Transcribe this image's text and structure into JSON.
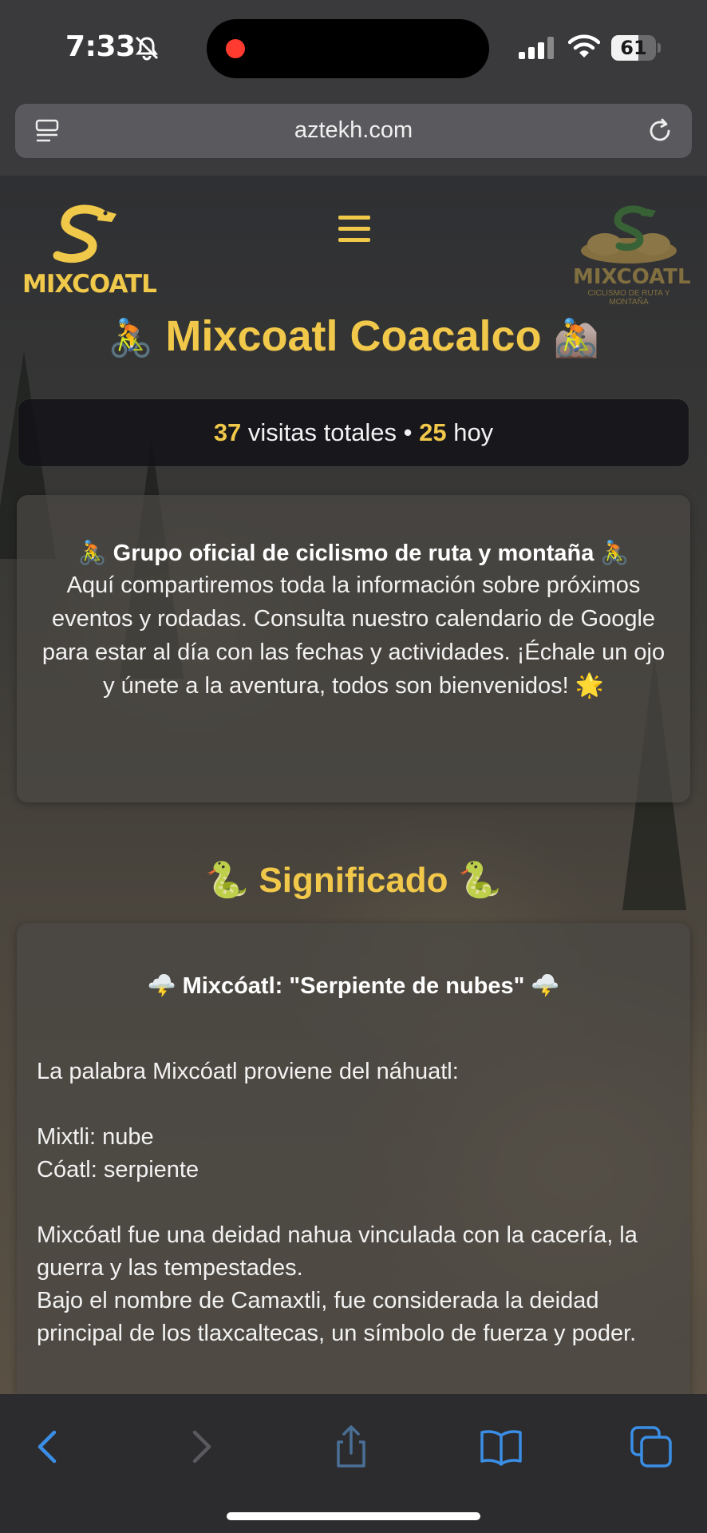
{
  "status": {
    "time": "7:33",
    "battery": "61",
    "battery_level": 0.61
  },
  "browser": {
    "url": "aztekh.com"
  },
  "header": {
    "logo_left_text": "MIXCOATL",
    "logo_right_text": "MIXCOATL",
    "logo_right_sub": "CICLISMO DE RUTA Y MONTAÑA"
  },
  "site": {
    "title_prefix_emoji": "🚴",
    "title": "Mixcoatl Coacalco",
    "title_suffix_emoji": "🚵"
  },
  "visits": {
    "total": "37",
    "total_label": "visitas totales •",
    "today": "25",
    "today_label": "hoy"
  },
  "intro": {
    "title": "🚴 Grupo oficial de ciclismo de ruta y montaña 🚴",
    "body": "Aquí compartiremos toda la información sobre próximos eventos y rodadas. Consulta nuestro calendario de Google para estar al día con las fechas y actividades. ¡Échale un ojo y únete a la aventura, todos son bienvenidos! 🌟"
  },
  "meaning": {
    "section_title": "🐍 Significado 🐍",
    "card_title": "🌩️ Mixcóatl: \"Serpiente de nubes\" 🌩️",
    "p1": "La palabra Mixcóatl proviene del náhuatl:",
    "p2": "Mixtli: nube",
    "p3": "Cóatl: serpiente",
    "p4": "Mixcóatl fue una deidad nahua vinculada con la cacería, la guerra y las tempestades.",
    "p5": "Bajo el nombre de Camaxtli, fue considerada la deidad principal de los tlaxcaltecas, un símbolo de fuerza y poder."
  },
  "colors": {
    "accent": "#f1c84a",
    "link_blue": "#3a8ee6"
  }
}
